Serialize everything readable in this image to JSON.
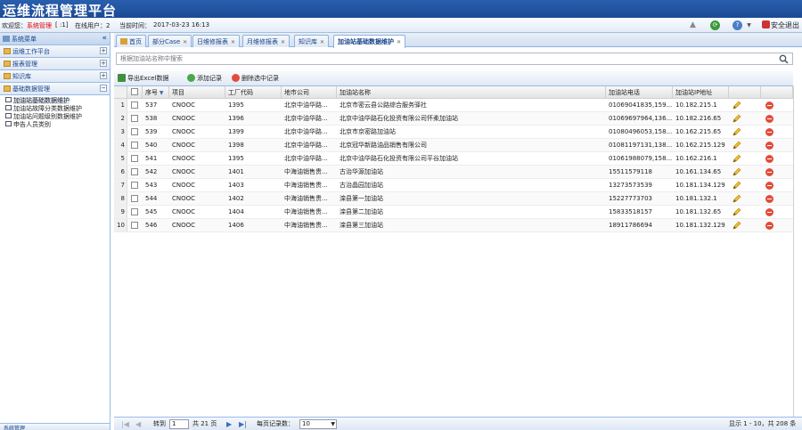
{
  "app": {
    "title": "运维流程管理平台"
  },
  "infobar": {
    "welcome_label": "欢迎您：",
    "user_name": "系统管理",
    "user_tag": "[ :1]",
    "online_label": "在线用户：2",
    "time_label": "当前时间：",
    "time_value": "2017-03-23 16:13",
    "logout_label": "安全退出"
  },
  "sidebar": {
    "header": "系统菜单",
    "sections": [
      {
        "label": "运维工作平台",
        "toggle": "+"
      },
      {
        "label": "报表管理",
        "toggle": "+"
      },
      {
        "label": "知识库",
        "toggle": "+"
      },
      {
        "label": "基础数据管理",
        "toggle": "−"
      }
    ],
    "tree_items": [
      "加油站基础数据维护",
      "加油站故障分类数据维护",
      "加油站问题级别数据维护",
      "申告人员类别"
    ],
    "bottom_label": "系统管理"
  },
  "tabs": [
    {
      "label": "首页"
    },
    {
      "label": "部分Case"
    },
    {
      "label": "日维修报表"
    },
    {
      "label": "月维修报表"
    },
    {
      "label": "知识库"
    },
    {
      "label": "加油站基础数据维护"
    }
  ],
  "search": {
    "placeholder": "根据加油站名称中搜索"
  },
  "toolbar": {
    "export_label": "导出Excel数据",
    "add_label": "添加记录",
    "delete_label": "删除选中记录"
  },
  "grid": {
    "columns": {
      "seq": "序号",
      "project": "项目",
      "factory_code": "工厂代码",
      "region": "地市公司",
      "station_name": "加油站名称",
      "phone": "加油站电话",
      "ip": "加油站IP地址"
    },
    "rows": [
      {
        "rn": "1",
        "seq": "537",
        "project": "CNOOC",
        "code": "1395",
        "region": "北京中油华路...",
        "name": "北京市密云县公路综合服务驿社",
        "phone": "01069041835,159...",
        "ip": "10.182.215.1"
      },
      {
        "rn": "2",
        "seq": "538",
        "project": "CNOOC",
        "code": "1396",
        "region": "北京中油华路...",
        "name": "北京中油华路石化投资有限公司怀柔加油站",
        "phone": "01069697964,136...",
        "ip": "10.182.216.65"
      },
      {
        "rn": "3",
        "seq": "539",
        "project": "CNOOC",
        "code": "1399",
        "region": "北京中油华路...",
        "name": "北京市京密路加油站",
        "phone": "01080496053,158...",
        "ip": "10.162.215.65"
      },
      {
        "rn": "4",
        "seq": "540",
        "project": "CNOOC",
        "code": "1398",
        "region": "北京中油华路...",
        "name": "北京冠华新路油品销售有限公司",
        "phone": "01081197131,138...",
        "ip": "10.162.215.129"
      },
      {
        "rn": "5",
        "seq": "541",
        "project": "CNOOC",
        "code": "1395",
        "region": "北京中油华路...",
        "name": "北京中油华路石化投资有限公司平谷加油站",
        "phone": "01061988079,158...",
        "ip": "10.162.216.1"
      },
      {
        "rn": "6",
        "seq": "542",
        "project": "CNOOC",
        "code": "1401",
        "region": "中海油销售贵...",
        "name": "古治华源加油站",
        "phone": "15511579118",
        "ip": "10.161.134.65"
      },
      {
        "rn": "7",
        "seq": "543",
        "project": "CNOOC",
        "code": "1403",
        "region": "中海油销售贵...",
        "name": "古治晶园加油站",
        "phone": "13273573539",
        "ip": "10.181.134.129"
      },
      {
        "rn": "8",
        "seq": "544",
        "project": "CNOOC",
        "code": "1402",
        "region": "中海油销售贵...",
        "name": "滦县第一加油站",
        "phone": "15227773703",
        "ip": "10.181.132.1"
      },
      {
        "rn": "9",
        "seq": "545",
        "project": "CNOOC",
        "code": "1404",
        "region": "中海油销售贵...",
        "name": "滦县第二加油站",
        "phone": "15833518157",
        "ip": "10.181.132.65"
      },
      {
        "rn": "10",
        "seq": "546",
        "project": "CNOOC",
        "code": "1406",
        "region": "中海油销售贵...",
        "name": "滦县第三加油站",
        "phone": "18911786694",
        "ip": "10.181.132.129"
      }
    ]
  },
  "pager": {
    "goto_label": "转到",
    "page_value": "1",
    "total_pages_label": "共 21 页",
    "page_size_label": "每页记录数：",
    "page_size_value": "10",
    "summary": "显示 1 - 10，共 208 条"
  }
}
